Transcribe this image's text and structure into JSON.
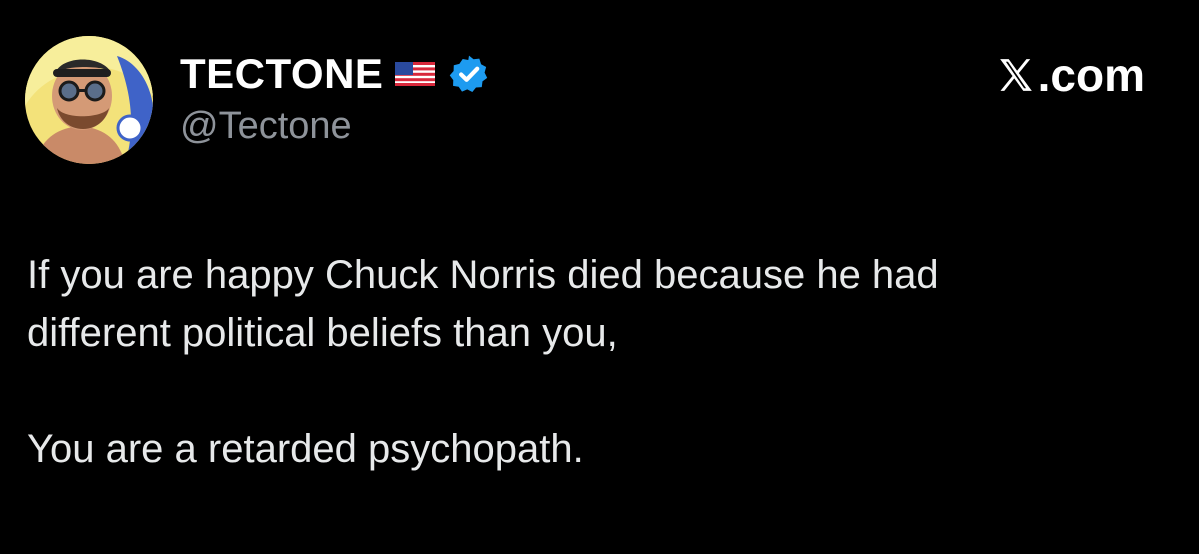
{
  "author": {
    "display_name": "TECTONE",
    "handle": "@Tectone",
    "flag_icon": "us-flag-icon",
    "verified_icon": "verified-badge-icon",
    "verified_color": "#1d9bf0"
  },
  "brand": {
    "suffix": ".com",
    "logo_icon": "x-logo-icon"
  },
  "tweet": {
    "line1": "If you are happy Chuck Norris died because he had",
    "line2": "different political beliefs than you,",
    "line3": "You are a retarded psychopath."
  },
  "colors": {
    "background": "#000000",
    "text": "#e7e9ea",
    "muted": "#8e939a"
  }
}
